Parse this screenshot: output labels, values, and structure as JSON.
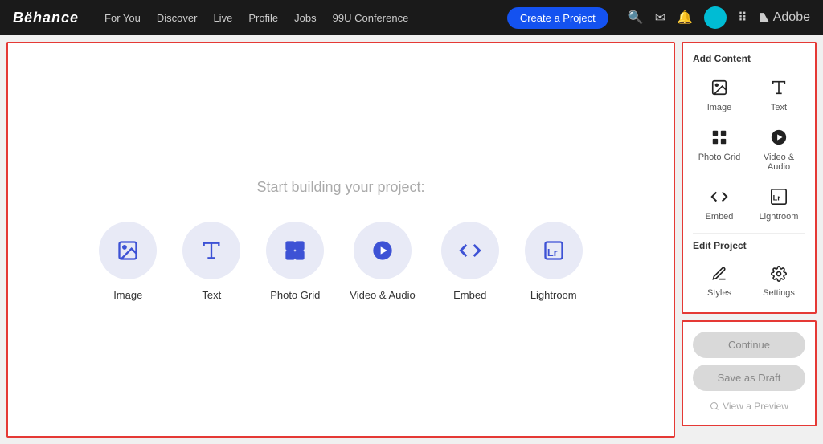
{
  "navbar": {
    "logo": "Bëhance",
    "nav_items": [
      "For You",
      "Discover",
      "Live",
      "Profile",
      "Jobs",
      "99U Conference"
    ],
    "create_label": "Create a Project",
    "adobe_label": "Adobe"
  },
  "canvas": {
    "prompt": "Start building your project:",
    "items": [
      {
        "id": "image",
        "label": "Image",
        "icon": "image"
      },
      {
        "id": "text",
        "label": "Text",
        "icon": "text"
      },
      {
        "id": "photo-grid",
        "label": "Photo Grid",
        "icon": "grid"
      },
      {
        "id": "video-audio",
        "label": "Video & Audio",
        "icon": "video"
      },
      {
        "id": "embed",
        "label": "Embed",
        "icon": "embed"
      },
      {
        "id": "lightroom",
        "label": "Lightroom",
        "icon": "lightroom"
      }
    ]
  },
  "sidebar": {
    "add_content_title": "Add Content",
    "add_content_items": [
      {
        "id": "image",
        "label": "Image",
        "icon": "image"
      },
      {
        "id": "text",
        "label": "Text",
        "icon": "text"
      },
      {
        "id": "photo-grid",
        "label": "Photo Grid",
        "icon": "grid"
      },
      {
        "id": "video-audio",
        "label": "Video & Audio",
        "icon": "video"
      },
      {
        "id": "embed",
        "label": "Embed",
        "icon": "embed"
      },
      {
        "id": "lightroom",
        "label": "Lightroom",
        "icon": "lr"
      }
    ],
    "edit_project_title": "Edit Project",
    "edit_items": [
      {
        "id": "styles",
        "label": "Styles",
        "icon": "brush"
      },
      {
        "id": "settings",
        "label": "Settings",
        "icon": "gear"
      }
    ]
  },
  "actions": {
    "continue_label": "Continue",
    "draft_label": "Save as Draft",
    "preview_label": "View a Preview"
  }
}
